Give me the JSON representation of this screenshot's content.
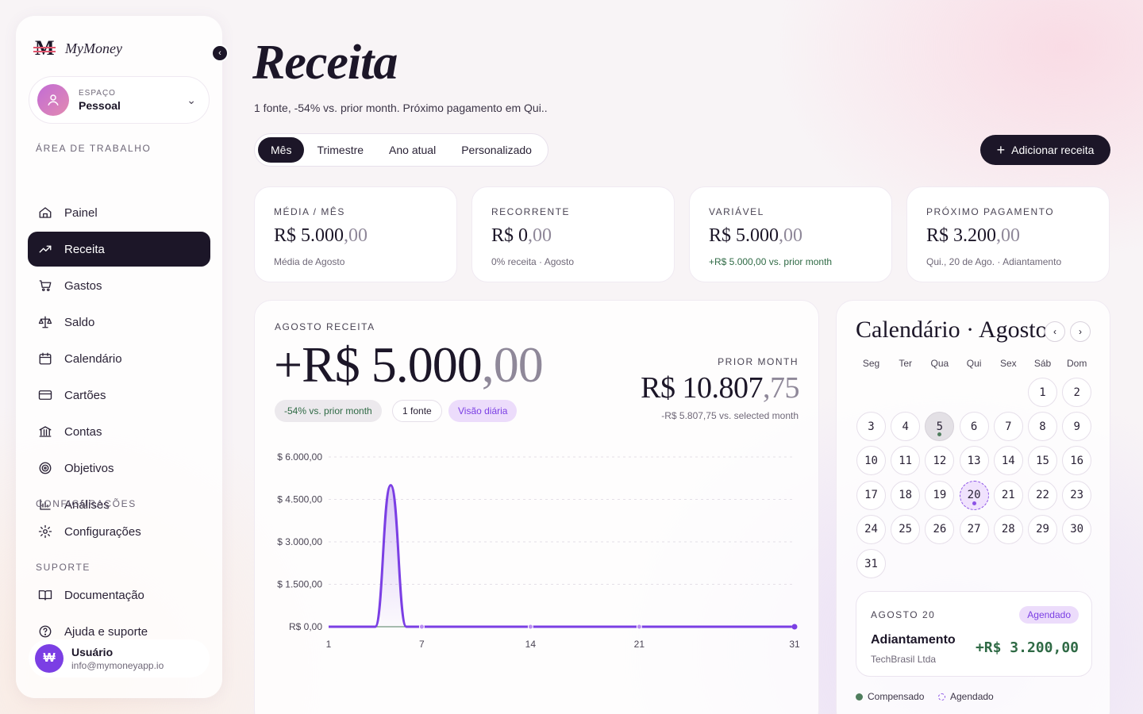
{
  "app": {
    "brand_mark": "₩",
    "brand_name": "MyMoney"
  },
  "sidebar": {
    "space": {
      "kicker": "ESPAÇO",
      "name": "Pessoal"
    },
    "sections": {
      "workspace": "ÁREA DE TRABALHO",
      "settings": "CONFIGURAÇÕES",
      "support": "SUPORTE"
    },
    "items": [
      {
        "label": "Painel",
        "icon": "home-icon"
      },
      {
        "label": "Receita",
        "icon": "trend-up-icon",
        "active": true
      },
      {
        "label": "Gastos",
        "icon": "cart-icon"
      },
      {
        "label": "Saldo",
        "icon": "scale-icon"
      },
      {
        "label": "Calendário",
        "icon": "calendar-icon"
      },
      {
        "label": "Cartões",
        "icon": "card-icon"
      },
      {
        "label": "Contas",
        "icon": "bank-icon"
      },
      {
        "label": "Objetivos",
        "icon": "target-icon"
      },
      {
        "label": "Análises",
        "icon": "bar-chart-icon"
      }
    ],
    "settings_items": [
      {
        "label": "Configurações",
        "icon": "gear-icon"
      }
    ],
    "support_items": [
      {
        "label": "Documentação",
        "icon": "book-icon"
      },
      {
        "label": "Ajuda e suporte",
        "icon": "help-icon"
      }
    ],
    "user": {
      "avatar": "₩",
      "name": "Usuário",
      "email": "info@mymoneyapp.io"
    }
  },
  "header": {
    "title": "Receita",
    "subtitle": "1 fonte, -54% vs. prior month. Próximo pagamento em Qui..",
    "periods": [
      "Mês",
      "Trimestre",
      "Ano atual",
      "Personalizado"
    ],
    "active_period": "Mês",
    "add_button": "Adicionar receita"
  },
  "stats": [
    {
      "label": "MÉDIA / MÊS",
      "int": "R$ 5.000",
      "dec": ",00",
      "sub": "Média de Agosto"
    },
    {
      "label": "RECORRENTE",
      "int": "R$ 0",
      "dec": ",00",
      "sub": "0% receita · Agosto"
    },
    {
      "label": "VARIÁVEL",
      "int": "R$ 5.000",
      "dec": ",00",
      "sub": "+R$ 5.000,00 vs. prior month"
    },
    {
      "label": "PRÓXIMO PAGAMENTO",
      "int": "R$ 3.200",
      "dec": ",00",
      "sub": "Qui., 20 de Ago. · Adiantamento"
    }
  ],
  "chart_panel": {
    "label": "AGOSTO RECEITA",
    "total_int": "+R$ 5.000",
    "total_dec": ",00",
    "pill_change": "-54% vs. prior month",
    "pill_sources": "1 fonte",
    "pill_daily": "Visão diária",
    "prior_label": "PRIOR MONTH",
    "prior_int": "R$ 10.807",
    "prior_dec": ",75",
    "prior_sub": "-R$ 5.807,75 vs. selected month"
  },
  "chart_data": {
    "type": "area",
    "x": [
      1,
      2,
      3,
      4,
      5,
      6,
      7,
      8,
      9,
      10,
      11,
      12,
      13,
      14,
      15,
      16,
      17,
      18,
      19,
      20,
      21,
      22,
      23,
      24,
      25,
      26,
      27,
      28,
      29,
      30,
      31
    ],
    "series": [
      {
        "values": [
          0,
          0,
          0,
          0,
          5000,
          0,
          0,
          0,
          0,
          0,
          0,
          0,
          0,
          0,
          0,
          0,
          0,
          0,
          0,
          0,
          0,
          0,
          0,
          0,
          0,
          0,
          0,
          0,
          0,
          0,
          0
        ]
      }
    ],
    "x_ticks": [
      1,
      7,
      14,
      21,
      31
    ],
    "y_ticks": [
      0,
      1500,
      3000,
      4500,
      6000
    ],
    "y_tick_labels": [
      "R$ 0,00",
      "$ 1.500,00",
      "$ 3.000,00",
      "$ 4.500,00",
      "$ 6.000,00"
    ],
    "ylim": [
      0,
      6000
    ],
    "grid": true,
    "color": "#7b3fe4"
  },
  "calendar": {
    "title": "Calendário · Agosto",
    "weekdays": [
      "Seg",
      "Ter",
      "Qua",
      "Qui",
      "Sex",
      "Sáb",
      "Dom"
    ],
    "first_weekday_index": 5,
    "days_in_month": 31,
    "today": 5,
    "scheduled": 20,
    "event": {
      "date": "AGOSTO 20",
      "badge": "Agendado",
      "name": "Adiantamento",
      "source": "TechBrasil Ltda",
      "amount": "+R$ 3.200,00"
    },
    "legend": {
      "paid": "Compensado",
      "scheduled": "Agendado"
    }
  },
  "colors": {
    "accent": "#7b3fe4",
    "dark": "#1c1628",
    "positive": "#2f6a45",
    "brand_strike": "#e0556e"
  }
}
